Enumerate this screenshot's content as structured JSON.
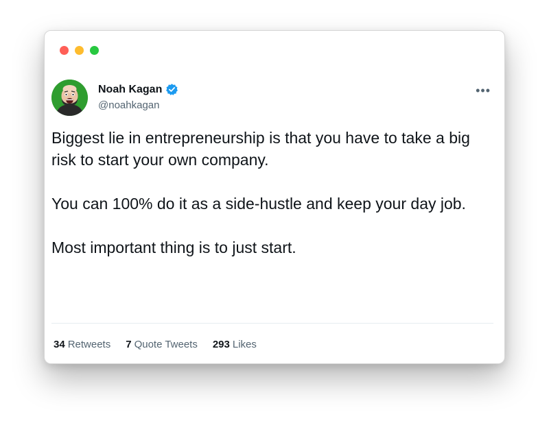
{
  "window": {
    "controls": [
      "close",
      "minimize",
      "zoom"
    ]
  },
  "tweet": {
    "author_name": "Noah Kagan",
    "author_handle": "@noahkagan",
    "verified": true,
    "more_label": "•••",
    "paragraphs": [
      "Biggest lie in entrepreneurship is that you have to take a big risk to start your own company.",
      "You can 100% do it as a side-hustle and keep your day job.",
      "Most important thing is to just start."
    ],
    "stats": {
      "retweets_count": "34",
      "retweets_label": "Retweets",
      "quotes_count": "7",
      "quotes_label": "Quote Tweets",
      "likes_count": "293",
      "likes_label": "Likes"
    }
  },
  "colors": {
    "close": "#ff5f57",
    "minimize": "#febc2e",
    "zoom": "#28c840",
    "verified_blue": "#1d9bf0",
    "text_primary": "#0f1419",
    "text_secondary": "#536471"
  }
}
